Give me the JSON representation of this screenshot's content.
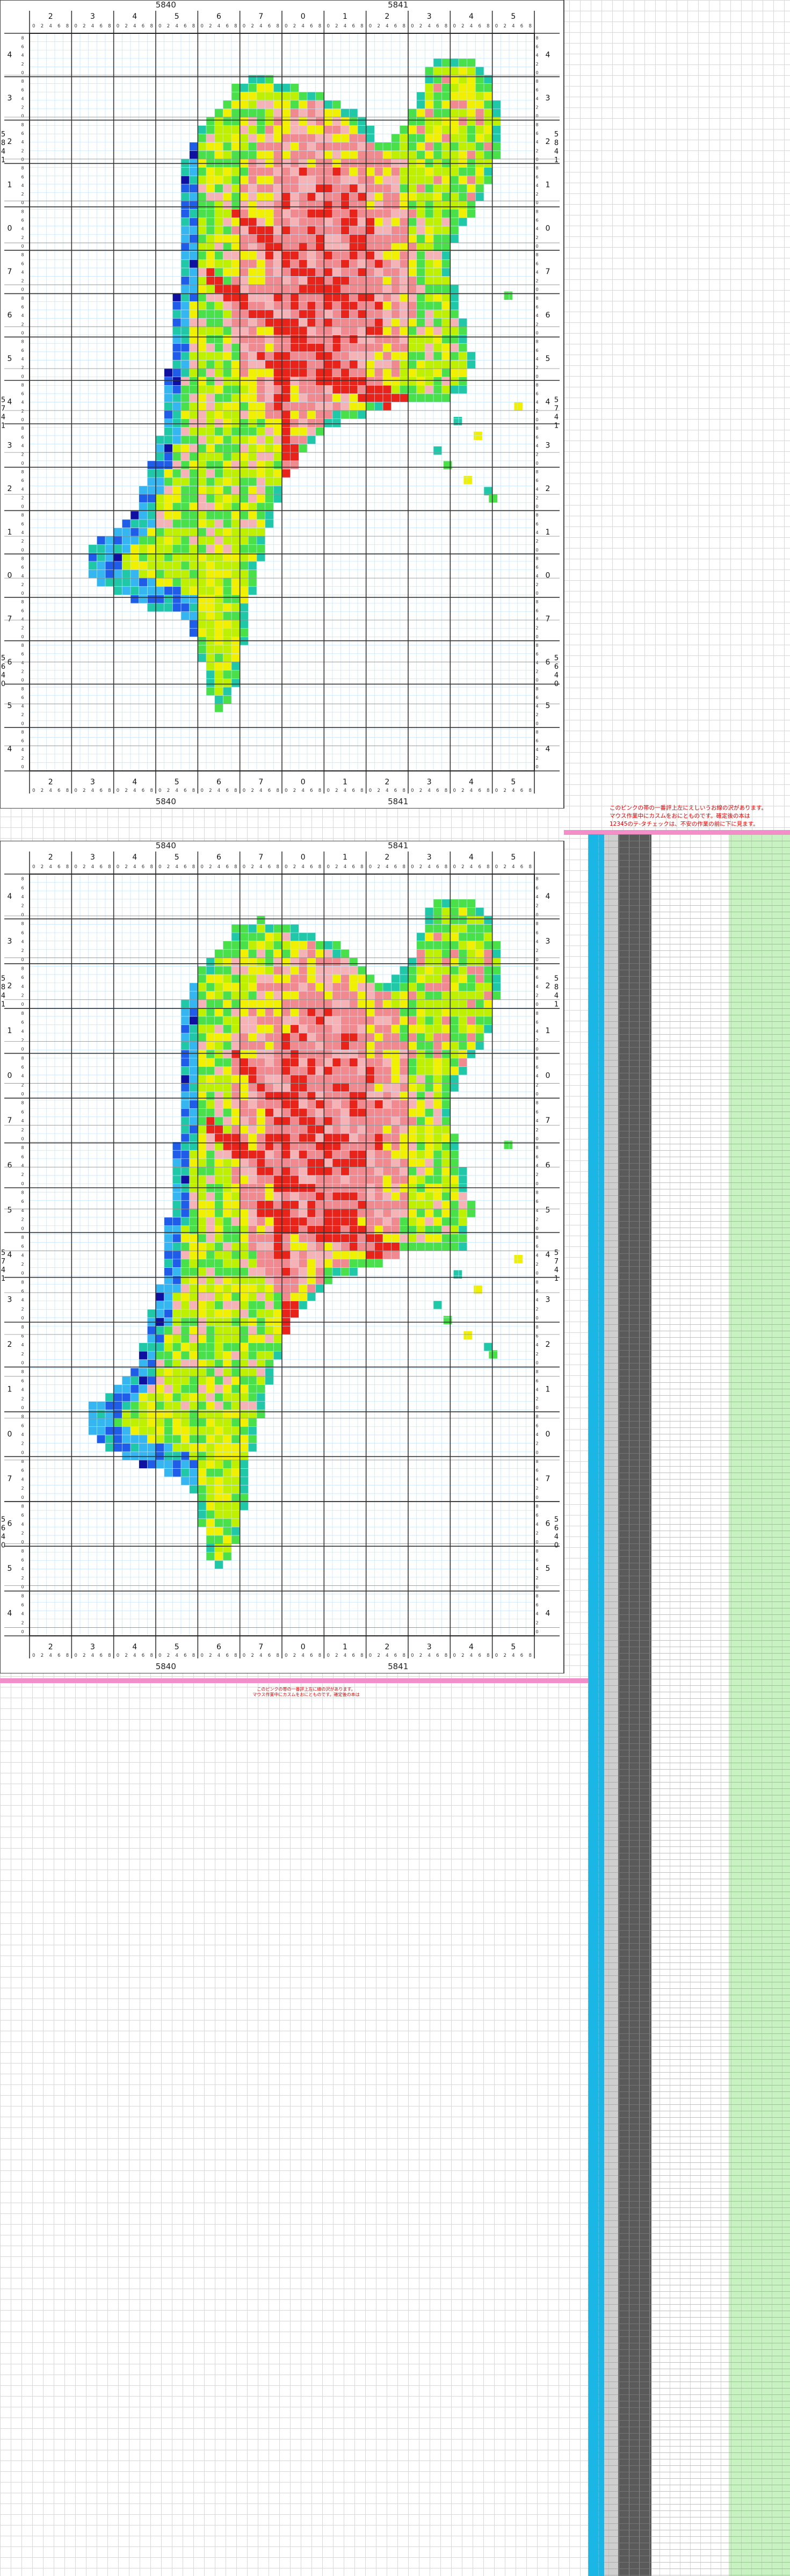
{
  "map_sheets": [
    {
      "left_code": "5840",
      "right_code": "5841"
    },
    {
      "left_code": "5840",
      "right_code": "5841"
    }
  ],
  "column_labels": [
    "2",
    "3",
    "4",
    "5",
    "6",
    "7",
    "0",
    "1",
    "2",
    "3",
    "4",
    "5"
  ],
  "sub_labels": [
    "0",
    "2",
    "4",
    "6",
    "8"
  ],
  "row_labels": [
    "4",
    "3",
    "2",
    "1",
    "0",
    "7",
    "6",
    "5",
    "4",
    "3",
    "2",
    "1",
    "0",
    "7",
    "6",
    "5",
    "4"
  ],
  "side_codes": {
    "upper": [
      "5",
      "8",
      "4",
      "1"
    ],
    "middle": [
      "5",
      "7",
      "4",
      "1"
    ],
    "lower": [
      "5",
      "6",
      "4",
      "0"
    ]
  },
  "palette": {
    "red": "#e8231a",
    "pink": "#f08a8e",
    "lightpink": "#f6b3b5",
    "yellow": "#f0f000",
    "lime": "#bff000",
    "green": "#49e04a",
    "teal": "#20c8a8",
    "cyan": "#35b6f0",
    "blue": "#1f5ce8",
    "navy": "#1010a0",
    "grid_minor": "#bfe3ff",
    "grid_major": "#333333"
  },
  "notice_main": "このピンクの帯の一番評上左にえしいうお線の沢があります。\nマウス作業中にカスムをおにとものです。確定後の本は\n12345のテ-タチェックは、不安の作業の前に下に見ます。",
  "notice_small": "このピンクの帯の一番評上左に線の沢があります。\nマウス作業中にカスムをおにとものです。確定後の本は"
}
